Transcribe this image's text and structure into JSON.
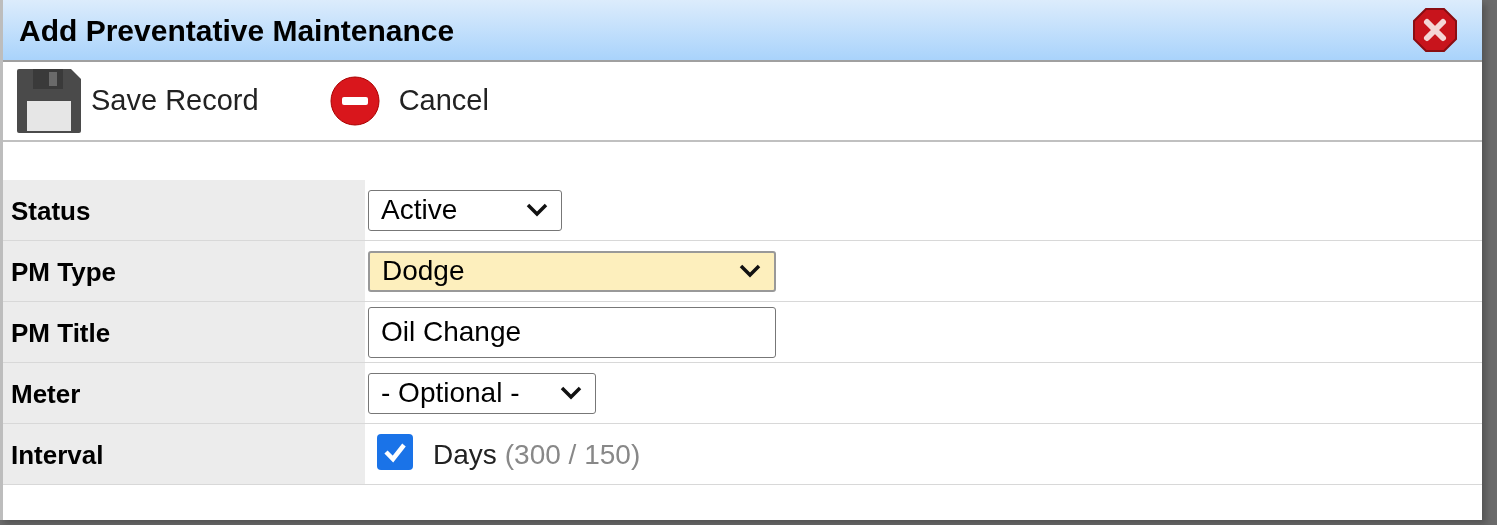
{
  "dialog": {
    "title": "Add Preventative Maintenance"
  },
  "toolbar": [
    {
      "kind": "save",
      "label": "Save Record"
    },
    {
      "kind": "cancel",
      "label": "Cancel"
    }
  ],
  "form_rows": [
    {
      "label": "Status",
      "kind": "select",
      "value": "Active",
      "highlighted": false
    },
    {
      "label": "PM Type",
      "kind": "select",
      "value": "Dodge",
      "highlighted": true
    },
    {
      "label": "PM Title",
      "kind": "text",
      "value": "Oil Change",
      "highlighted": false
    },
    {
      "label": "Meter",
      "kind": "select",
      "value": "- Optional -",
      "highlighted": false
    },
    {
      "label": "Interval",
      "kind": "checkbox",
      "checked": true,
      "value": "Days",
      "note": "(300 / 150)"
    }
  ]
}
